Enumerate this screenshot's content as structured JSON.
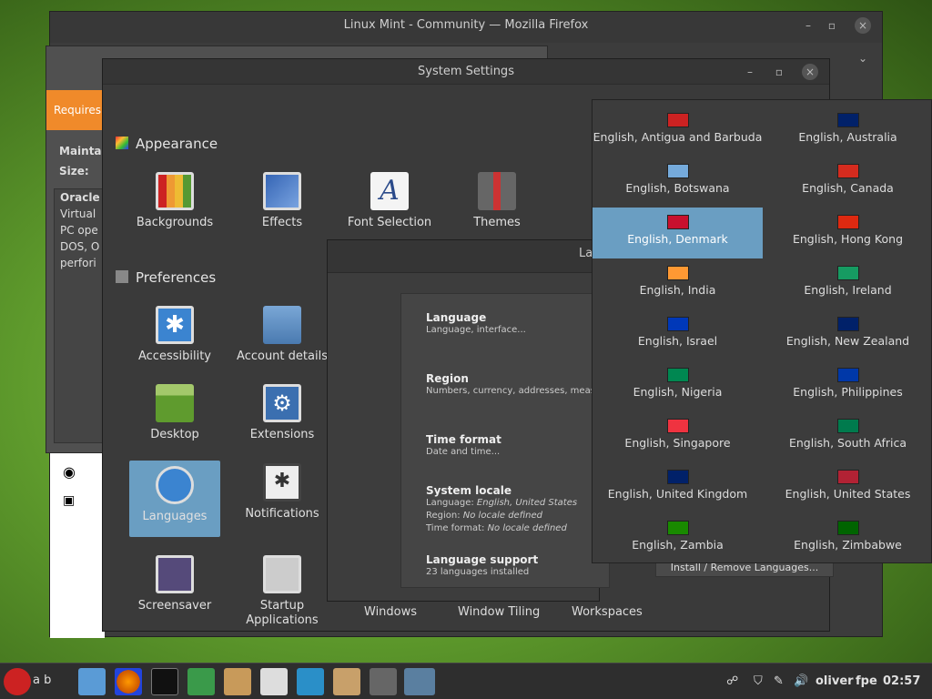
{
  "firefox": {
    "title": "Linux Mint - Community — Mozilla Firefox"
  },
  "vb": {
    "orange": "Requires",
    "labels": [
      "Maintai",
      "Size:"
    ],
    "bold": "Oracle",
    "text": [
      "Virtual",
      "PC ope",
      "DOS, O",
      "perfori"
    ]
  },
  "settings": {
    "title": "System Settings",
    "appearance": "Appearance",
    "preferences": "Preferences",
    "tiles": {
      "backgrounds": "Backgrounds",
      "effects": "Effects",
      "font": "Font Selection",
      "themes": "Themes",
      "accessibility": "Accessibility",
      "account": "Account details",
      "desktop": "Desktop",
      "extensions": "Extensions",
      "languages": "Languages",
      "notifications": "Notifications",
      "screensaver": "Screensaver",
      "startup1": "Startup",
      "startup2": "Applications"
    },
    "bottom": [
      "Windows",
      "Window Tiling",
      "Workspaces"
    ]
  },
  "langwin": {
    "title": "La",
    "language": {
      "label": "Language",
      "desc": "Language, interface..."
    },
    "region": {
      "label": "Region",
      "desc": "Numbers, currency, addresses, meas"
    },
    "time": {
      "label": "Time format",
      "desc": "Date and time..."
    },
    "locale": {
      "label": "System locale",
      "lang_k": "Language: ",
      "lang_v": "English, United States",
      "region_k": "Region: ",
      "region_v": "No locale defined",
      "time_k": "Time format: ",
      "time_v": "No locale defined"
    },
    "support": {
      "label": "Language support",
      "desc": "23 languages installed",
      "button": "Install / Remove Languages..."
    }
  },
  "popup": {
    "items": [
      "English, Antigua and Barbuda",
      "English, Australia",
      "English, Botswana",
      "English, Canada",
      "English, Denmark",
      "English, Hong Kong",
      "English, India",
      "English, Ireland",
      "English, Israel",
      "English, New Zealand",
      "English, Nigeria",
      "English, Philippines",
      "English, Singapore",
      "English, South Africa",
      "English, United Kingdom",
      "English, United States",
      "English, Zambia",
      "English, Zimbabwe"
    ],
    "selected": "English, Denmark"
  },
  "taskbar": {
    "menu_label": "a b",
    "user": "oliver",
    "kb": "fpe",
    "time": "02:57"
  }
}
